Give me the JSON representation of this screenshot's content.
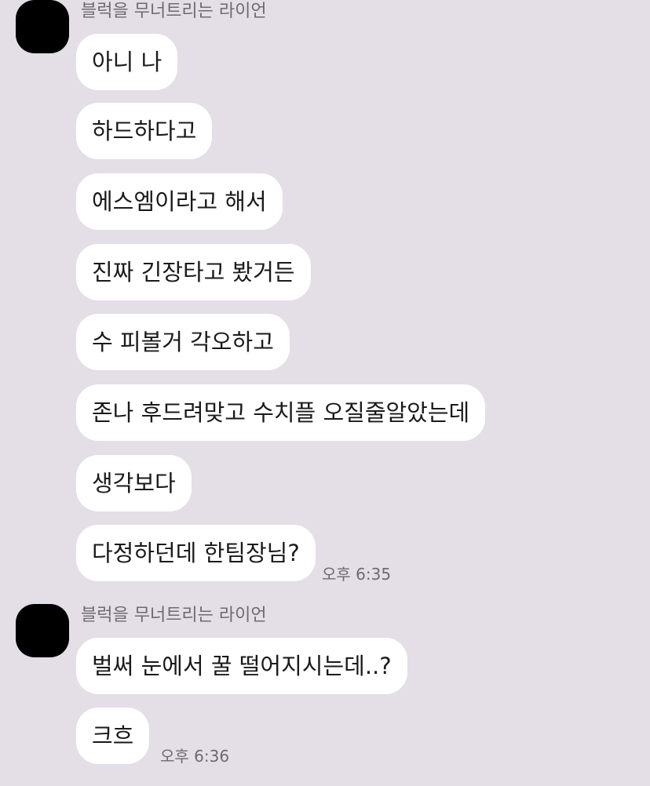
{
  "groups": [
    {
      "sender": "블럭을 무너트리는 라이언",
      "messages": [
        "아니 나",
        "하드하다고",
        "에스엠이라고 해서",
        "진짜 긴장타고 봤거든",
        "수 피볼거 각오하고",
        "존나 후드려맞고 수치플 오질줄알았는데",
        "생각보다",
        "다정하던데 한팀장님?"
      ],
      "time": "오후 6:35"
    },
    {
      "sender": "블럭을 무너트리는 라이언",
      "messages": [
        "벌써 눈에서 꿀 떨어지시는데..?",
        "크흐"
      ],
      "time": "오후 6:36"
    }
  ]
}
